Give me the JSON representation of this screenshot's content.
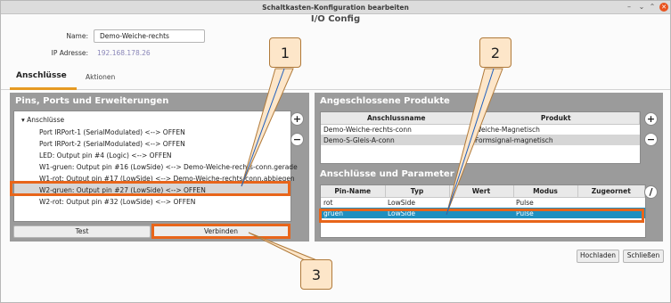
{
  "window": {
    "title": "Schaltkasten-Konfiguration bearbeiten",
    "app_title": "I/O Config",
    "btn_minimize": "–",
    "btn_restore": "⌄",
    "btn_maximize": "⌃",
    "btn_close": "✕"
  },
  "form": {
    "name_label": "Name:",
    "name_value": "Demo-Weiche-rechts",
    "ip_label": "IP Adresse:",
    "ip_value": "192.168.178.26"
  },
  "tabs": [
    {
      "label": "Anschlüsse",
      "active": true
    },
    {
      "label": "Aktionen",
      "active": false
    }
  ],
  "left_panel": {
    "title": "Pins, Ports und Erweiterungen",
    "root_label": "Anschlüsse",
    "items": [
      "Port IRPort-1 (SerialModulated) <--> OFFEN",
      "Port IRPort-2 (SerialModulated) <--> OFFEN",
      "LED: Output pin #4 (Logic) <--> OFFEN",
      "W1-gruen: Output pin #16 (LowSide) <--> Demo-Weiche-rechts-conn.gerade",
      "W1-rot: Output pin #17 (LowSide) <--> Demo-Weiche-rechts-conn.abbiegen",
      "W2-gruen: Output pin #27 (LowSide) <--> OFFEN",
      "W2-rot: Output pin #32 (LowSide) <--> OFFEN"
    ],
    "test_button": "Test",
    "connect_button": "Verbinden",
    "add_button": "+",
    "remove_button": "−"
  },
  "right_panel": {
    "products_title": "Angeschlossene Produkte",
    "products_columns": [
      "Anschlussname",
      "Produkt"
    ],
    "products_rows": [
      [
        "Demo-Weiche-rechts-conn",
        "Weiche-Magnetisch"
      ],
      [
        "Demo-S-Gleis-A-conn",
        "Formsignal-magnetisch"
      ]
    ],
    "params_title": "Anschlüsse und Parameter",
    "params_columns": [
      "Pin-Name",
      "Typ",
      "Wert",
      "Modus",
      "Zugeornet"
    ],
    "params_rows": [
      [
        "rot",
        "LowSide",
        "",
        "Pulse",
        ""
      ],
      [
        "gruen",
        "LowSide",
        "",
        "Pulse",
        ""
      ]
    ],
    "add_button": "+",
    "remove_button": "−",
    "edit_button": "/"
  },
  "footer": {
    "reload_button": "Hochladen",
    "close_button": "Schließen"
  },
  "callouts": [
    "1",
    "2",
    "3"
  ],
  "colors": {
    "highlight": "#e8651a",
    "selection": "#1f8fbf",
    "panel": "#9b9b9b",
    "tab_accent": "#e69a22",
    "callout_fill": "#fde6c9"
  }
}
